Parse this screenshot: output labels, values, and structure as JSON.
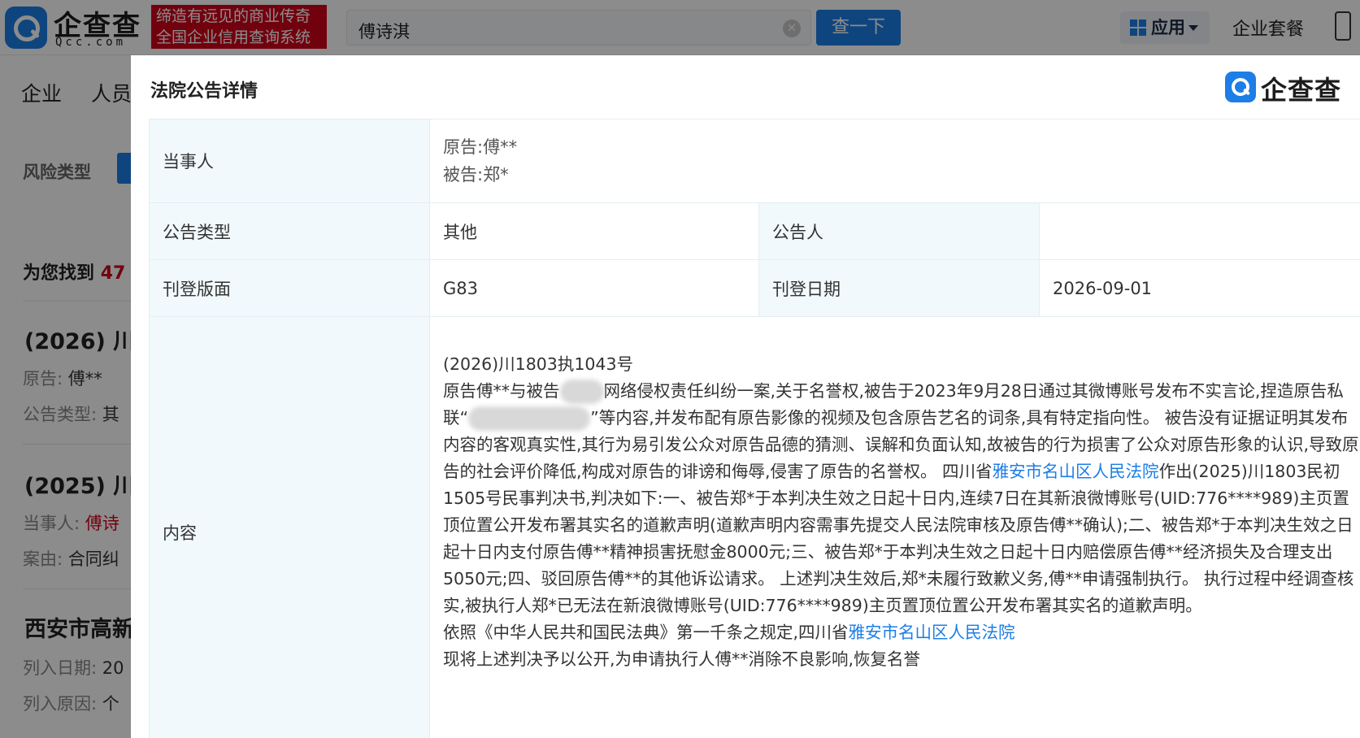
{
  "topbar": {
    "logo_text": "企查查",
    "logo_sub": "Qcc.com",
    "slogan_line1": "缔造有远见的商业传奇",
    "slogan_line2": "全国企业信用查询系统",
    "search_value": "傅诗淇",
    "search_button": "查一下",
    "apps_label": "应用",
    "package_label": "企业套餐"
  },
  "nav": {
    "item1": "企业",
    "item2": "人员"
  },
  "background": {
    "risk_label": "风险类型",
    "found_prefix": "为您找到",
    "found_count": "47",
    "r1_title": "(2026) 川",
    "r1_plaintiff_label": "原告:",
    "r1_plaintiff_value": "傅**",
    "r1_type_label": "公告类型:",
    "r1_type_value": "其",
    "r2_title": "(2025) 川",
    "r2_party_label": "当事人:",
    "r2_party_value": "傅诗",
    "r2_cause_label": "案由:",
    "r2_cause_value": "合同纠",
    "r3_title": "西安市高新",
    "r3_date_label": "列入日期:",
    "r3_date_value": "20",
    "r3_reason_label": "列入原因:",
    "r3_reason_value": "个"
  },
  "modal": {
    "title": "法院公告详情",
    "logo_text": "企查查",
    "party_label": "当事人",
    "plaintiff": "原告:傅**",
    "defendant": "被告:郑*",
    "type_label": "公告类型",
    "type_value": "其他",
    "announcer_label": "公告人",
    "announcer_value": "",
    "page_label": "刊登版面",
    "page_value": "G83",
    "date_label": "刊登日期",
    "date_value": "2026-09-01",
    "content_label": "内容",
    "content": {
      "case_no": "(2026)川1803执1043号",
      "p1_a": "原告傅**与被告",
      "p1_b": "网络侵权责任纠纷一案,关于名誉权,被告于2023年9月28日通过其微博账号发布不实言论,捏造原告私联“",
      "p1_c": "”等内容,并发布配有原告影像的视频及包含原告艺名的词条,具有特定指向性。 被告没有证据证明其发布内容的客观真实性,其行为易引发公众对原告品德的猜测、误解和负面认知,故被告的行为损害了公众对原告形象的认识,导致原告的社会评价降低,构成对原告的诽谤和侮辱,侵害了原告的名誉权。 四川省",
      "court_link_1": "雅安市名山区人民法院",
      "p1_d": "作出(2025)川1803民初1505号民事判决书,判决如下:一、被告郑*于本判决生效之日起十日内,连续7日在其新浪微博账号(UID:776****989)主页置顶位置公开发布署其实名的道歉声明(道歉声明内容需事先提交人民法院审核及原告傅**确认);二、被告郑*于本判决生效之日起十日内支付原告傅**精神损害抚慰金8000元;三、被告郑*于本判决生效之日起十日内赔偿原告傅**经济损失及合理支出5050元;四、驳回原告傅**的其他诉讼请求。 上述判决生效后,郑*未履行致歉义务,傅**申请强制执行。 执行过程中经调查核实,被执行人郑*已无法在新浪微博账号(UID:776****989)主页置顶位置公开发布署其实名的道歉声明。",
      "p2_a": "依照《中华人民共和国民法典》第一千条之规定,四川省",
      "court_link_2": "雅安市名山区人民法院",
      "p3": "现将上述判决予以公开,为申请执行人傅**消除不良影响,恢复名誉"
    }
  }
}
